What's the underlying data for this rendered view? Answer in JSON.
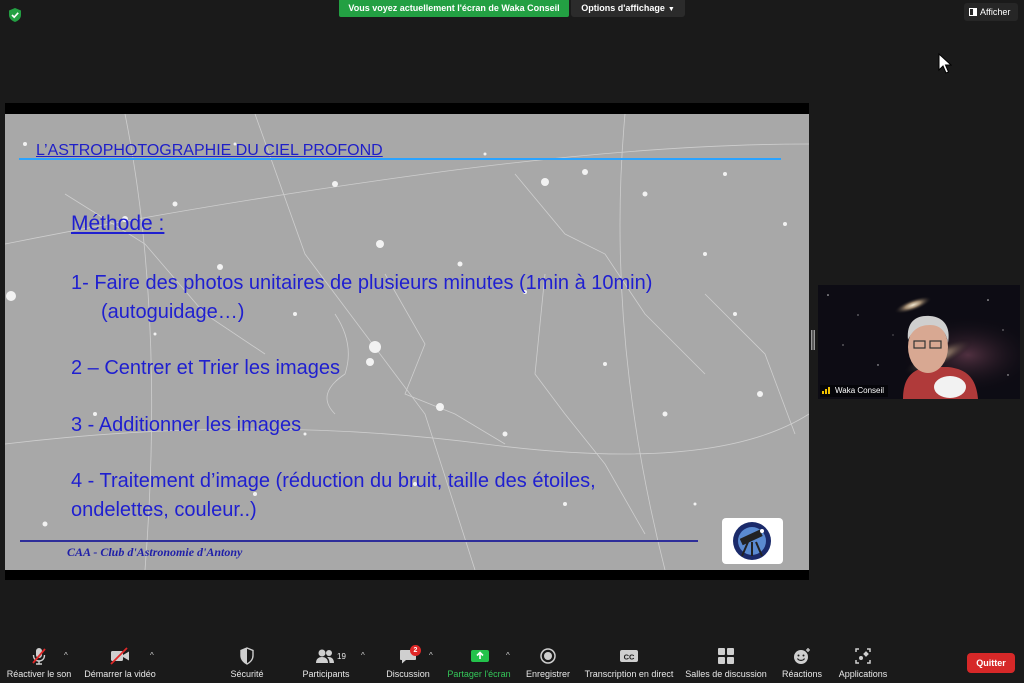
{
  "topbar": {
    "share_banner": "Vous voyez actuellement l'écran de Waka Conseil",
    "view_options": "Options d'affichage",
    "show_button": "Afficher"
  },
  "slide": {
    "title": "L’ASTROPHOTOGRAPHIE DU CIEL PROFOND",
    "heading": "Méthode :",
    "items": [
      "1- Faire des photos unitaires de plusieurs minutes (1min à 10min)",
      "(autoguidage…)",
      "2 – Centrer et Trier les images",
      "3 - Additionner les images",
      "4 - Traitement d’image (réduction du bruit, taille des étoiles,",
      "ondelettes, couleur..)"
    ],
    "footer": "CAA - Club d'Astronomie d'Antony"
  },
  "video": {
    "participant_name": "Waka Conseil"
  },
  "toolbar": {
    "unmute": "Réactiver le son",
    "start_video": "Démarrer la vidéo",
    "security": "Sécurité",
    "participants": "Participants",
    "participants_count": "19",
    "chat": "Discussion",
    "chat_badge": "2",
    "share_screen": "Partager l'écran",
    "record": "Enregistrer",
    "transcription": "Transcription en direct",
    "breakout_rooms": "Salles de discussion",
    "reactions": "Réactions",
    "apps": "Applications",
    "quit": "Quitter"
  },
  "colors": {
    "share_green": "#23a043",
    "slide_text": "#1f1fd0",
    "title_line": "#2aa3ff",
    "quit_red": "#d62828"
  }
}
